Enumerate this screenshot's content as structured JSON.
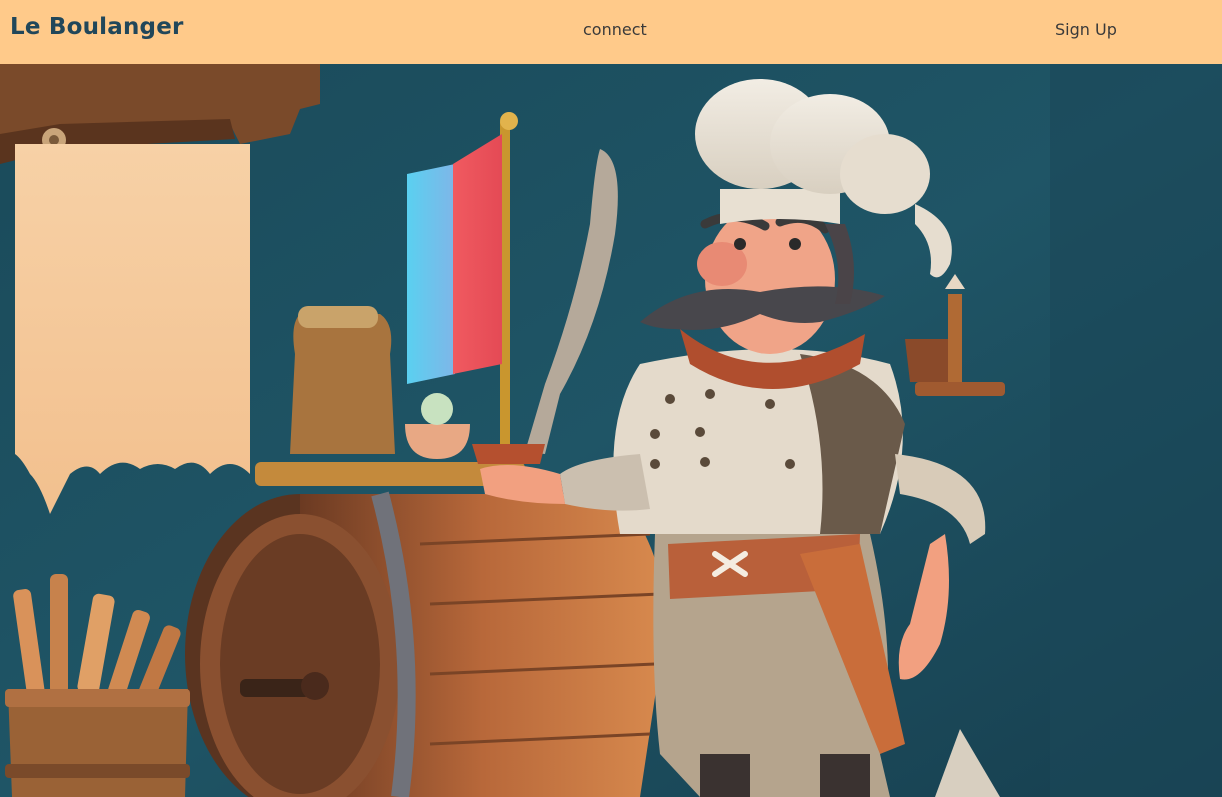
{
  "header": {
    "brand": "Le Boulanger",
    "nav": {
      "connect_label": "connect",
      "signup_label": "Sign Up"
    }
  },
  "colors": {
    "navbar_bg": "#FFCA8A",
    "brand_text": "#21475A",
    "hero_bg": "#1F4E5F"
  },
  "hero": {
    "illustration": "cartoon-baker-chef-with-barrel-and-flag"
  }
}
